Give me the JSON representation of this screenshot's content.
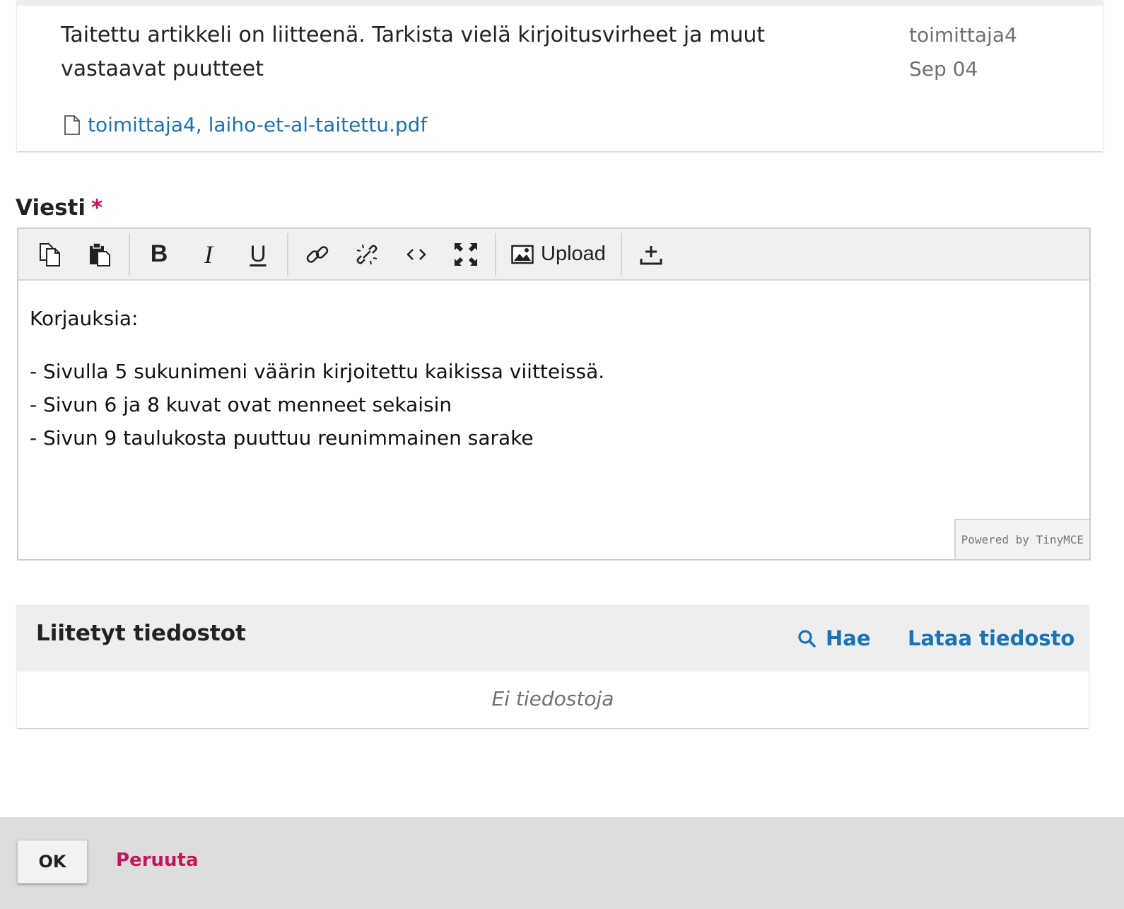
{
  "previous_message": {
    "text": "Taitettu artikkeli on liitteenä. Tarkista vielä kirjoitusvirheet ja muut vastaavat puutteet",
    "author": "toimittaja4",
    "date": "Sep 04",
    "attachment": "toimittaja4, laiho-et-al-taitettu.pdf"
  },
  "message_field": {
    "label": "Viesti",
    "required_marker": "*"
  },
  "toolbar": {
    "upload_label": "Upload",
    "icons": [
      "copy-icon",
      "paste-icon",
      "bold-icon",
      "italic-icon",
      "underline-icon",
      "link-icon",
      "unlink-icon",
      "code-icon",
      "fullscreen-icon",
      "image-upload-icon",
      "insert-icon"
    ]
  },
  "editor": {
    "line1": "Korjauksia:",
    "line2": "- Sivulla 5 sukunimeni väärin kirjoitettu kaikissa viitteissä.",
    "line3": "- Sivun 6 ja 8 kuvat ovat menneet sekaisin",
    "line4": "- Sivun 9 taulukosta puuttuu reunimmainen sarake",
    "powered_by": "Powered by TinyMCE"
  },
  "attached_files": {
    "title": "Liitetyt tiedostot",
    "search_label": "Hae",
    "upload_label": "Lataa tiedosto",
    "empty_text": "Ei tiedostoja"
  },
  "footer": {
    "ok_label": "OK",
    "cancel_label": "Peruuta"
  },
  "colors": {
    "link_blue": "#1a73b4",
    "accent_pink": "#c2185b",
    "panel_grey": "#eeeeee",
    "footer_grey": "#dddddd"
  }
}
